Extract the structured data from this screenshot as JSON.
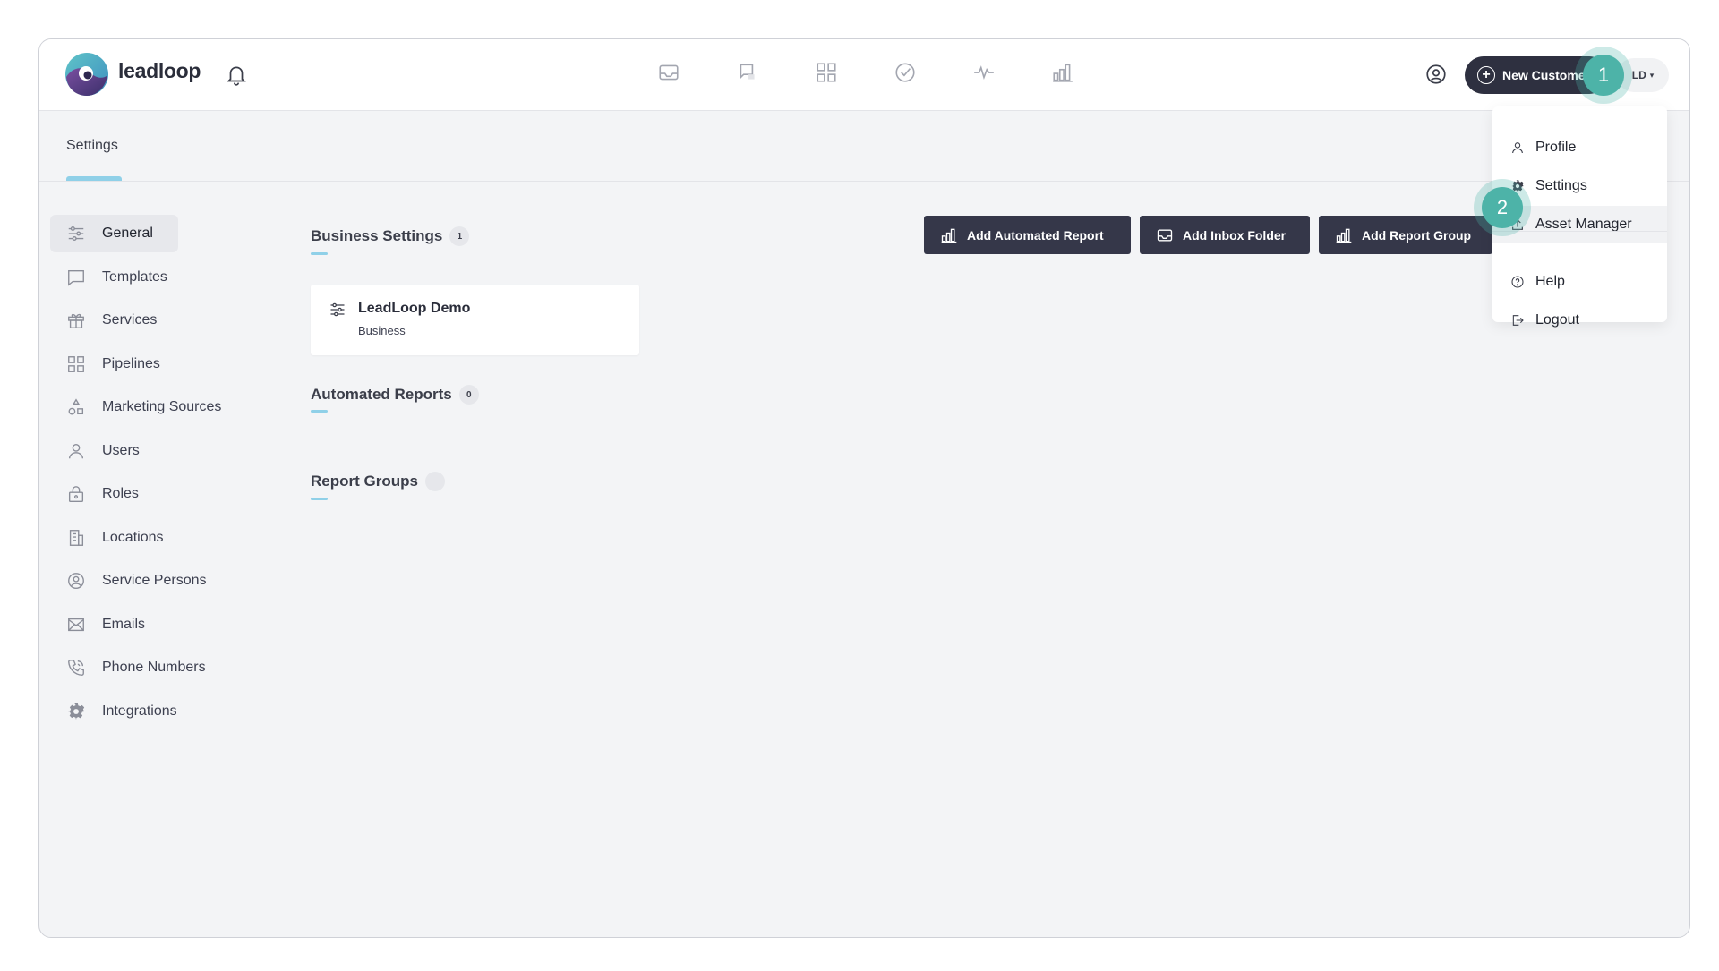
{
  "header": {
    "brand": "leadloop",
    "new_customer_label": "New Customer",
    "avatar_initials": "LD"
  },
  "nav": {
    "icons": [
      "inbox-icon",
      "chat-icon",
      "pipelines-icon",
      "tasks-icon",
      "activity-icon",
      "reports-icon"
    ]
  },
  "steps": {
    "one": "1",
    "two": "2"
  },
  "subheader": {
    "title": "Settings"
  },
  "sidebar": {
    "items": [
      {
        "label": "General",
        "icon": "sliders-icon"
      },
      {
        "label": "Templates",
        "icon": "message-icon"
      },
      {
        "label": "Services",
        "icon": "gift-icon"
      },
      {
        "label": "Pipelines",
        "icon": "grid-icon"
      },
      {
        "label": "Marketing Sources",
        "icon": "shapes-icon"
      },
      {
        "label": "Users",
        "icon": "user-icon"
      },
      {
        "label": "Roles",
        "icon": "lock-icon"
      },
      {
        "label": "Locations",
        "icon": "building-icon"
      },
      {
        "label": "Service Persons",
        "icon": "person-circle-icon"
      },
      {
        "label": "Emails",
        "icon": "mail-icon"
      },
      {
        "label": "Phone Numbers",
        "icon": "phone-icon"
      },
      {
        "label": "Integrations",
        "icon": "gear-icon"
      }
    ]
  },
  "main": {
    "business_settings": {
      "title": "Business Settings",
      "count": "1"
    },
    "business_card": {
      "name": "LeadLoop Demo",
      "type": "Business"
    },
    "automated_reports": {
      "title": "Automated Reports",
      "count": "0"
    },
    "report_groups": {
      "title": "Report Groups",
      "count": ""
    },
    "buttons": {
      "add_automated_report": "Add Automated Report",
      "add_inbox_folder": "Add Inbox Folder",
      "add_report_group": "Add Report Group"
    }
  },
  "dropdown": {
    "items": [
      {
        "label": "Profile",
        "icon": "user-icon"
      },
      {
        "label": "Settings",
        "icon": "gear-icon"
      },
      {
        "label": "Asset Manager",
        "icon": "upload-icon"
      },
      {
        "label": "Help",
        "icon": "help-icon"
      },
      {
        "label": "Logout",
        "icon": "logout-icon"
      }
    ]
  }
}
